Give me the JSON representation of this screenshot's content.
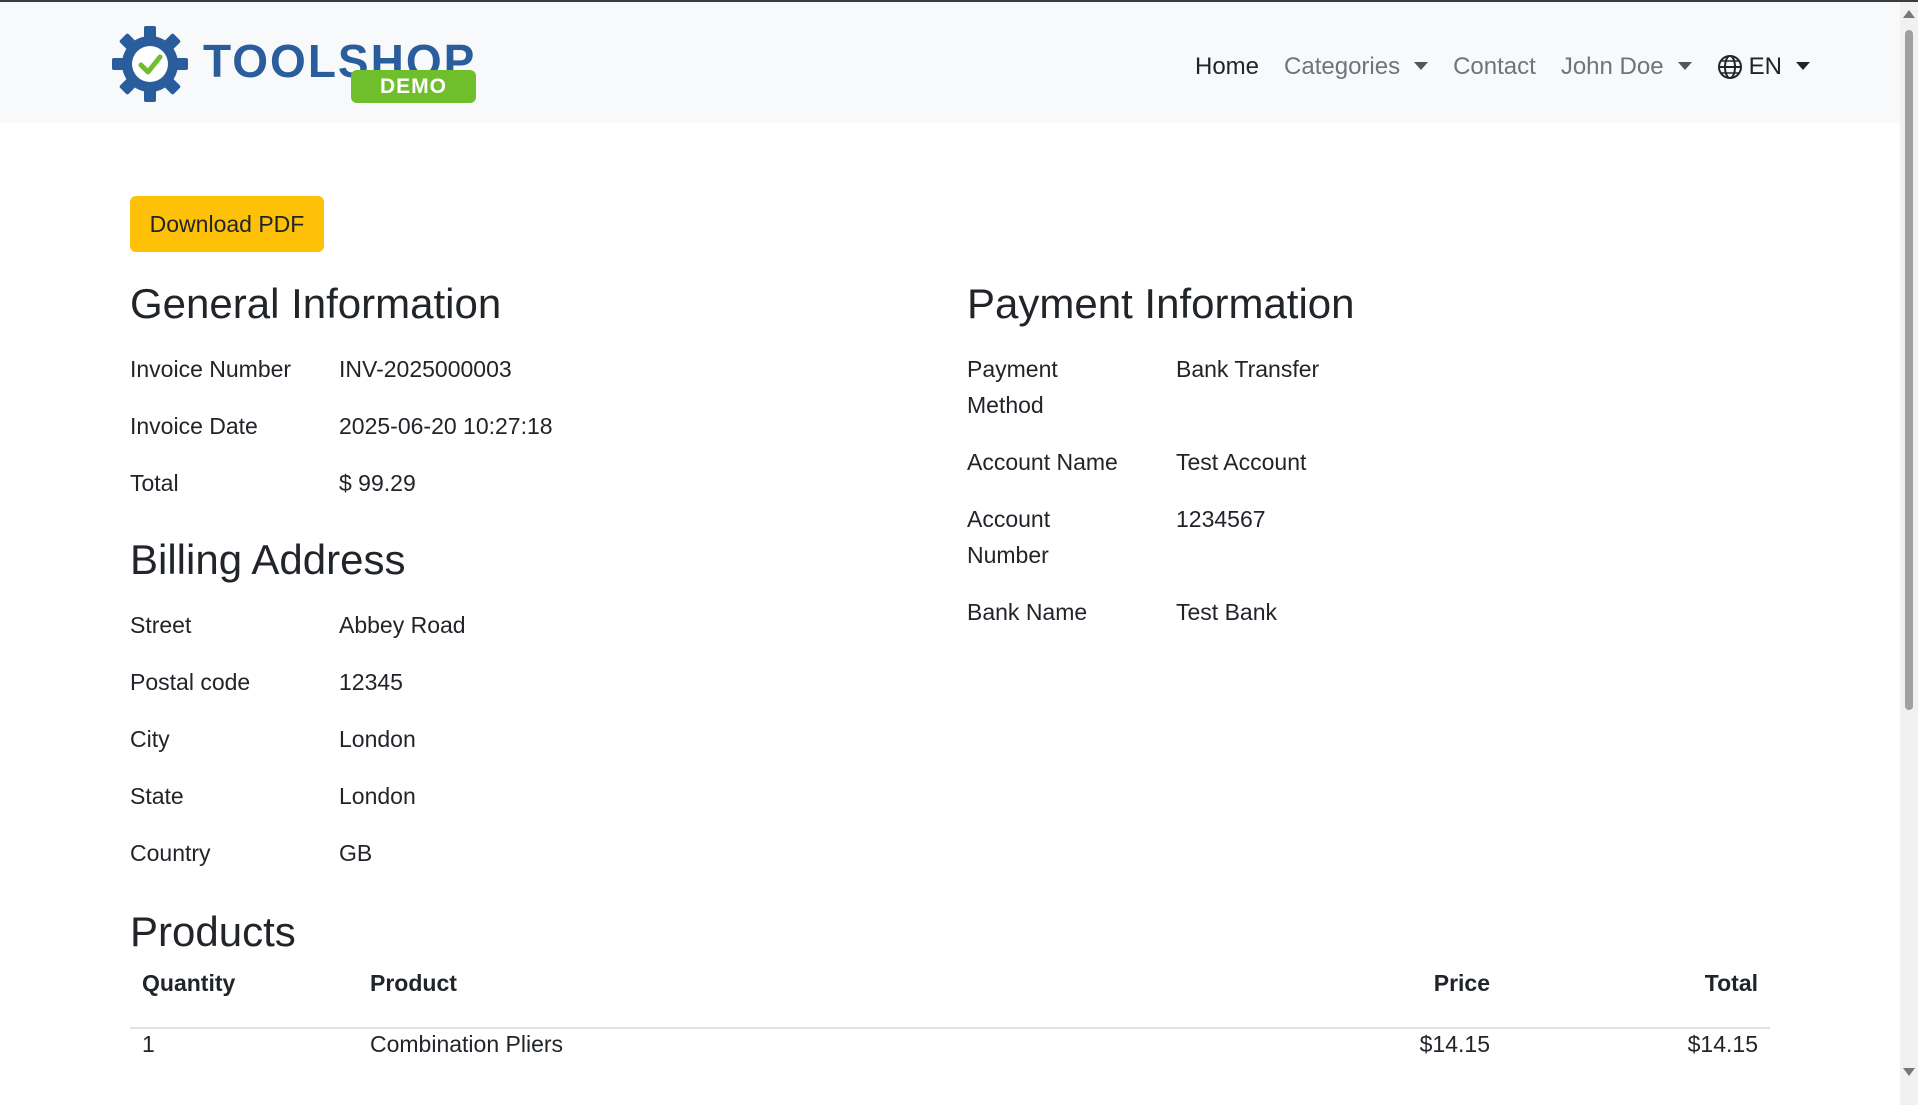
{
  "brand": {
    "name": "TOOLSHOP",
    "badge": "DEMO",
    "accent_blue": "#2a5d9c",
    "accent_green": "#6fbf2c"
  },
  "nav": {
    "home": "Home",
    "categories": "Categories",
    "contact": "Contact",
    "user": "John Doe",
    "language": "EN"
  },
  "actions": {
    "download_pdf": "Download PDF"
  },
  "general": {
    "heading": "General Information",
    "rows": [
      {
        "label": "Invoice Number",
        "value": "INV-2025000003"
      },
      {
        "label": "Invoice Date",
        "value": "2025-06-20 10:27:18"
      },
      {
        "label": "Total",
        "value": "$ 99.29"
      }
    ]
  },
  "payment": {
    "heading": "Payment Information",
    "rows": [
      {
        "label_line1": "Payment",
        "label_line2": "Method",
        "value": "Bank Transfer"
      },
      {
        "label_line1": "Account Name",
        "label_line2": "",
        "value": "Test Account"
      },
      {
        "label_line1": "Account",
        "label_line2": "Number",
        "value": "1234567"
      },
      {
        "label_line1": "Bank Name",
        "label_line2": "",
        "value": "Test Bank"
      }
    ]
  },
  "billing": {
    "heading": "Billing Address",
    "rows": [
      {
        "label": "Street",
        "value": "Abbey Road"
      },
      {
        "label": "Postal code",
        "value": "12345"
      },
      {
        "label": "City",
        "value": "London"
      },
      {
        "label": "State",
        "value": "London"
      },
      {
        "label": "Country",
        "value": "GB"
      }
    ]
  },
  "products": {
    "heading": "Products",
    "columns": [
      "Quantity",
      "Product",
      "Price",
      "Total"
    ],
    "rows": [
      {
        "quantity": "1",
        "product": "Combination Pliers",
        "price": "$14.15",
        "total": "$14.15"
      }
    ]
  },
  "colors": {
    "button_yellow": "#ffc107",
    "navbar_bg": "#f8f9fa"
  }
}
